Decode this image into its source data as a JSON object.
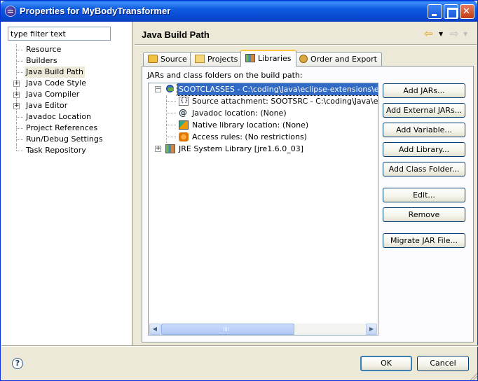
{
  "window": {
    "title": "Properties for MyBodyTransformer",
    "icon": "eclipse-icon",
    "controls": [
      "minimize-icon",
      "maximize-icon",
      "close-icon"
    ]
  },
  "filter": {
    "placeholder": "type filter text",
    "value": "type filter text"
  },
  "nav_tree": {
    "items": [
      {
        "label": "Resource",
        "expandable": false
      },
      {
        "label": "Builders",
        "expandable": false
      },
      {
        "label": "Java Build Path",
        "expandable": false,
        "selected": true
      },
      {
        "label": "Java Code Style",
        "expandable": true
      },
      {
        "label": "Java Compiler",
        "expandable": true
      },
      {
        "label": "Java Editor",
        "expandable": true
      },
      {
        "label": "Javadoc Location",
        "expandable": false
      },
      {
        "label": "Project References",
        "expandable": false
      },
      {
        "label": "Run/Debug Settings",
        "expandable": false
      },
      {
        "label": "Task Repository",
        "expandable": false
      }
    ]
  },
  "header": {
    "title": "Java Build Path",
    "back_icon": "back-arrow-icon",
    "forward_icon": "forward-arrow-icon"
  },
  "tabs": [
    {
      "label": "Source",
      "icon": "source-folder-icon"
    },
    {
      "label": "Projects",
      "icon": "projects-icon"
    },
    {
      "label": "Libraries",
      "icon": "libraries-icon",
      "active": true
    },
    {
      "label": "Order and Export",
      "icon": "order-export-icon"
    }
  ],
  "libraries": {
    "caption": "JARs and class folders on the build path:",
    "tree": [
      {
        "label": "SOOTCLASSES - C:\\coding\\Java\\eclipse-extensions\\eclipse",
        "icon": "jar-icon",
        "expanded": true,
        "selected": true
      },
      {
        "label": "Source attachment: SOOTSRC - C:\\coding\\Java\\eclipse",
        "icon": "source-attachment-icon",
        "child": true
      },
      {
        "label": "Javadoc location: (None)",
        "icon": "javadoc-icon",
        "child": true
      },
      {
        "label": "Native library location: (None)",
        "icon": "native-library-icon",
        "child": true
      },
      {
        "label": "Access rules: (No restrictions)",
        "icon": "access-rules-icon",
        "child": true
      },
      {
        "label": "JRE System Library [jre1.6.0_03]",
        "icon": "library-icon",
        "expanded": false
      }
    ],
    "buttons": {
      "add_jars": "Add JARs...",
      "add_external_jars": "Add External JARs...",
      "add_variable": "Add Variable...",
      "add_library": "Add Library...",
      "add_class_folder": "Add Class Folder...",
      "edit": "Edit...",
      "remove": "Remove",
      "migrate_jar": "Migrate JAR File..."
    }
  },
  "footer": {
    "ok": "OK",
    "cancel": "Cancel",
    "help_icon": "help-icon",
    "help_glyph": "?"
  }
}
